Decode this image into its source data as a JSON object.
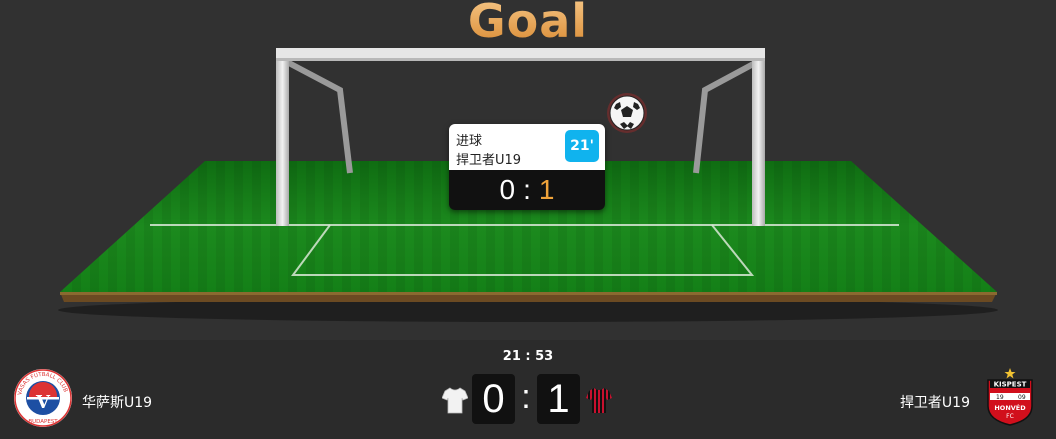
{
  "animation": {
    "title": "Goal",
    "event_label": "进球",
    "event_team": "捍卫者U19",
    "event_minute": "21'",
    "home_score": "0",
    "score_separator": ":",
    "away_score": "1"
  },
  "match": {
    "clock": "21 : 53",
    "home_team": "华萨斯U19",
    "away_team": "捍卫者U19",
    "home_score": "0",
    "score_separator": ":",
    "away_score": "1",
    "home_logo_text": [
      "VASAS FUTBALL CLUB",
      "BUDAPEST",
      "V"
    ],
    "away_logo_text": [
      "KISPEST",
      "19",
      "09",
      "HONVÉD",
      "FC"
    ]
  },
  "colors": {
    "minute_badge": "#10b3ee",
    "away_score_highlight": "#f0a33a",
    "pitch": "#1f8a1f",
    "title": "#e7a154"
  },
  "icons": {
    "ball": "soccer-ball-icon",
    "home_kit": "white-shirt-icon",
    "away_kit": "red-black-striped-shirt-icon"
  }
}
